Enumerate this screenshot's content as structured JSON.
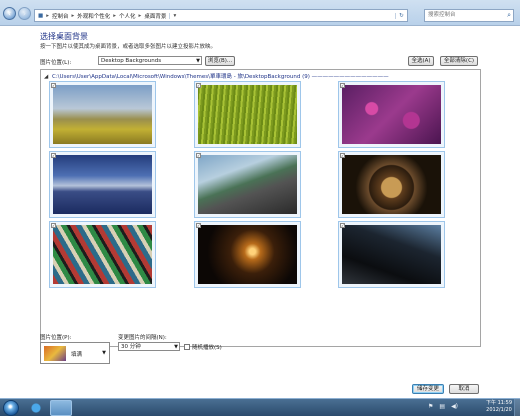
{
  "addressbar": {
    "back_icon": "back-arrow-icon",
    "forward_icon": "forward-arrow-icon",
    "breadcrumbs": [
      "控制台",
      "外观和个性化",
      "个人化",
      "桌面背景"
    ],
    "search_placeholder": "搜索控制台"
  },
  "page": {
    "title": "选择桌面背景",
    "description": "按一下图片以使其成为桌面背景，或者选取多张图片以建立投影片放映。",
    "location_label": "图片位置(L):",
    "location_value": "Desktop Backgrounds",
    "browse_label": "浏览(B)...",
    "select_all_label": "全选(A)",
    "clear_all_label": "全部清除(C)"
  },
  "gallery": {
    "folder_path": "C:\\Users\\User\\AppData\\Local\\Microsoft\\Windows\\Themes\\單車環島 - 旅\\DesktopBackground (9)",
    "thumbnails": [
      {
        "subject": "bicycle-field-photo",
        "checked": "✓"
      },
      {
        "subject": "grass-photo",
        "checked": "✓"
      },
      {
        "subject": "purple-flowers-photo",
        "checked": "✓"
      },
      {
        "subject": "mountain-riders-photo",
        "checked": "✓"
      },
      {
        "subject": "coastal-road-photo",
        "checked": "✓"
      },
      {
        "subject": "cat-wheel-photo",
        "checked": "✓"
      },
      {
        "subject": "sneakers-photo",
        "checked": "✓"
      },
      {
        "subject": "tunnel-photo",
        "checked": "✓"
      },
      {
        "subject": "bicycle-wheel-photo",
        "checked": "✓"
      }
    ]
  },
  "options": {
    "position_label": "图片位置(P):",
    "position_value": "填满",
    "interval_label": "变更图片的间隔(N):",
    "interval_value": "30 分钟",
    "shuffle_label": "随机播放(S)"
  },
  "footer": {
    "save_label": "储存变更",
    "cancel_label": "取消"
  },
  "taskbar": {
    "time": "下午 11:59",
    "date": "2012/1/20"
  }
}
